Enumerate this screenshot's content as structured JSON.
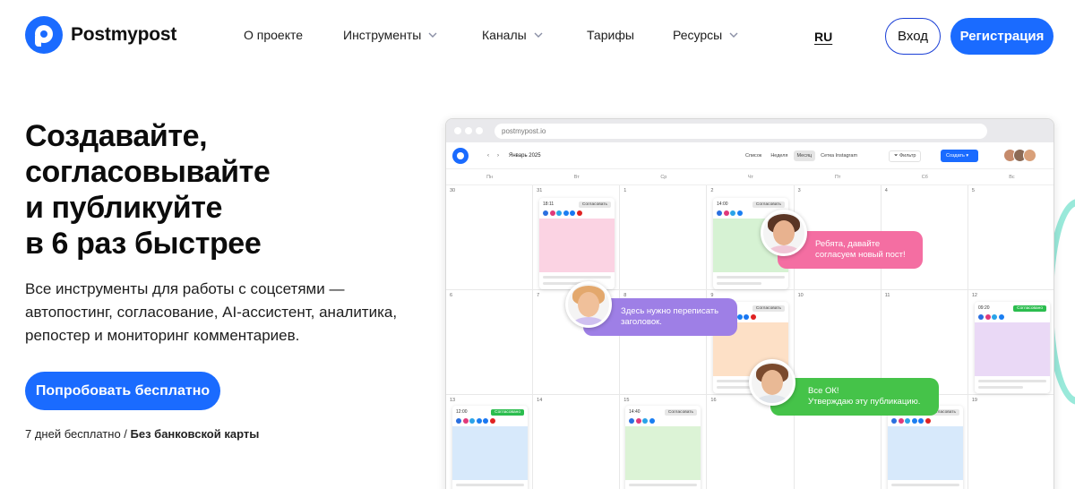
{
  "brand": {
    "name": "Postmypost"
  },
  "nav": {
    "items": [
      {
        "label": "О проекте",
        "dropdown": false
      },
      {
        "label": "Инструменты",
        "dropdown": true
      },
      {
        "label": "Каналы",
        "dropdown": true
      },
      {
        "label": "Тарифы",
        "dropdown": false
      },
      {
        "label": "Ресурсы",
        "dropdown": true
      }
    ],
    "lang": "RU",
    "login": "Вход",
    "register": "Регистрация"
  },
  "hero": {
    "title_lines": [
      "Создавайте,",
      "согласовывайте",
      "и публикуйте",
      "в 6 раз быстрее"
    ],
    "subtitle_lines": [
      "Все инструменты для работы с соцсетями —",
      "автопостинг, согласование, AI-ассистент, аналитика,",
      "репостер и мониторинг комментариев."
    ],
    "cta": "Попробовать бесплатно",
    "note_plain": "7 дней бесплатно / ",
    "note_bold": "Без банковской карты"
  },
  "mockup": {
    "url": "postmypost.io",
    "month": "Январь 2025",
    "views": [
      "Список",
      "Неделя",
      "Месяц",
      "Сетка Instagram"
    ],
    "active_view": "Месяц",
    "filter": "Фильтр",
    "create": "Создать",
    "weekdays": [
      "Пн",
      "Вт",
      "Ср",
      "Чт",
      "Пт",
      "Сб",
      "Вс"
    ],
    "dates": [
      [
        "30",
        "31",
        "1",
        "2",
        "3",
        "4",
        "5"
      ],
      [
        "6",
        "7",
        "8",
        "9",
        "10",
        "11",
        "12"
      ],
      [
        "13",
        "14",
        "15",
        "16",
        "17",
        "18",
        "19"
      ]
    ],
    "posts": [
      {
        "time": "18:11",
        "status": "Согласовать",
        "status_type": "grey",
        "color": "#fbd3e3"
      },
      {
        "time": "14:00",
        "status": "Согласовать",
        "status_type": "grey",
        "color": "#d6f2d3"
      },
      {
        "time": "",
        "status": "Согласовать",
        "status_type": "grey",
        "color": "#fde0c6"
      },
      {
        "time": "09:20",
        "status": "Согласовано",
        "status_type": "green",
        "color": "#ead9f6"
      },
      {
        "time": "12:00",
        "status": "Согласовано",
        "status_type": "green",
        "color": "#d7e9fb"
      },
      {
        "time": "14:40",
        "status": "Согласовать",
        "status_type": "grey",
        "color": "#dcf3d6"
      },
      {
        "time": "",
        "status": "Согласовать",
        "status_type": "grey",
        "color": "#d7e9fb"
      }
    ],
    "chats": [
      {
        "lines": [
          "Ребята, давайте",
          "согласуем новый пост!"
        ],
        "color": "#f46ea2"
      },
      {
        "lines": [
          "Здесь нужно переписать",
          "заголовок."
        ],
        "color": "#9e7fe6"
      },
      {
        "lines": [
          "Все ОК!",
          "Утверждаю эту публикацию."
        ],
        "color": "#45c349"
      }
    ]
  },
  "colors": {
    "accent": "#1a6bff",
    "login_border": "#1a3fd6"
  }
}
